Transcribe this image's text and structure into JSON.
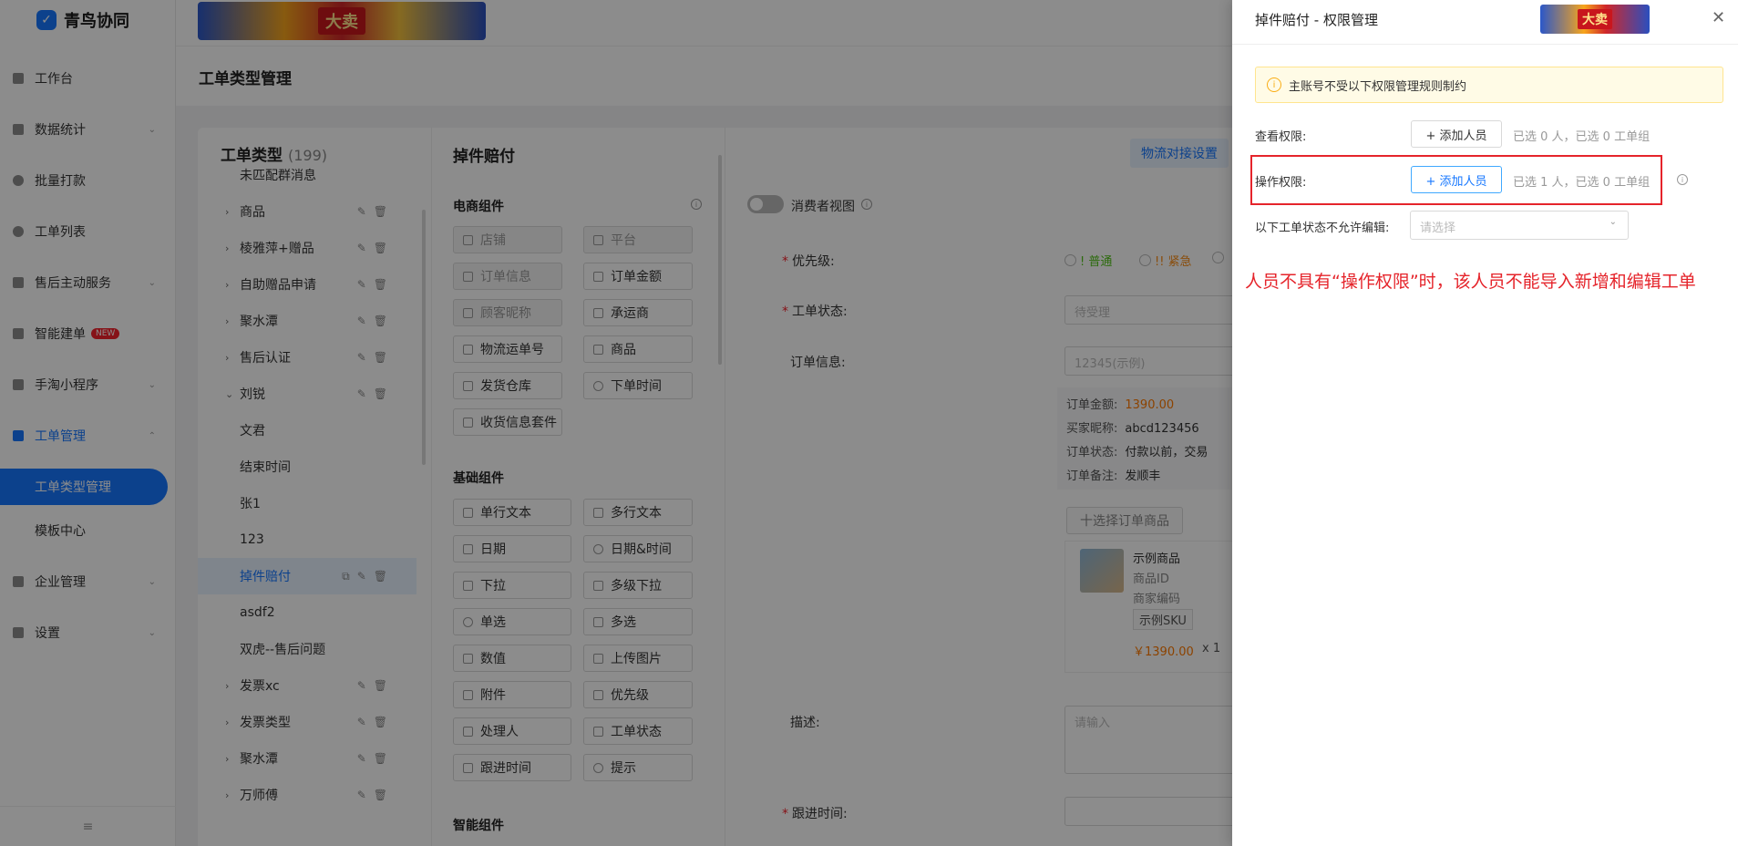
{
  "app": {
    "logo_text": "青鸟协同",
    "collapse_icon": "≡"
  },
  "sidebar": {
    "items": [
      {
        "label": "工作台"
      },
      {
        "label": "数据统计"
      },
      {
        "label": "批量打款"
      },
      {
        "label": "工单列表"
      },
      {
        "label": "售后主动服务"
      },
      {
        "label": "智能建单",
        "badge": "NEW"
      },
      {
        "label": "手淘小程序"
      },
      {
        "label": "工单管理"
      },
      {
        "label": "企业管理"
      },
      {
        "label": "设置"
      }
    ],
    "subitems": [
      {
        "label": "工单类型管理"
      },
      {
        "label": "模板中心"
      }
    ]
  },
  "banner": {
    "text": "大卖"
  },
  "page": {
    "title": "工单类型管理"
  },
  "tree": {
    "title": "工单类型",
    "count": "(199)",
    "rows": [
      {
        "label": "未匹配群消息"
      },
      {
        "label": "商品"
      },
      {
        "label": "棱雅萍+赠品"
      },
      {
        "label": "自助赠品申请"
      },
      {
        "label": "聚水潭"
      },
      {
        "label": "售后认证"
      },
      {
        "label": "刘锐"
      },
      {
        "label": "文君"
      },
      {
        "label": "结束时间"
      },
      {
        "label": "张1"
      },
      {
        "label": "123"
      },
      {
        "label": "掉件赔付"
      },
      {
        "label": "asdf2"
      },
      {
        "label": "双虎--售后问题"
      },
      {
        "label": "发票xc"
      },
      {
        "label": "发票类型"
      },
      {
        "label": "聚水潭"
      },
      {
        "label": "万师傅"
      }
    ]
  },
  "components": {
    "title": "掉件赔付",
    "logistics_label": "物流对接设置",
    "ecommerce_title": "电商组件",
    "ecommerce": [
      "店铺",
      "平台",
      "订单信息",
      "订单金额",
      "顾客昵称",
      "承运商",
      "物流运单号",
      "商品",
      "发货仓库",
      "下单时间",
      "收货信息套件"
    ],
    "basic_title": "基础组件",
    "basic": [
      "单行文本",
      "多行文本",
      "日期",
      "日期&时间",
      "下拉",
      "多级下拉",
      "单选",
      "多选",
      "数值",
      "上传图片",
      "附件",
      "优先级",
      "处理人",
      "工单状态",
      "跟进时间",
      "提示"
    ],
    "smart_title": "智能组件"
  },
  "preview": {
    "consumer_view": "消费者视图",
    "priority_label": "优先级:",
    "priority_normal": "! 普通",
    "priority_urgent": "!! 紧急",
    "status_label": "工单状态:",
    "status_placeholder": "待受理",
    "order_label": "订单信息:",
    "order_placeholder": "12345(示例)",
    "order_amount_k": "订单金额:",
    "order_amount_v": "1390.00",
    "buyer_k": "买家昵称:",
    "buyer_v": "abcd123456",
    "order_status_k": "订单状态:",
    "order_status_v": "付款以前，交易",
    "order_note_k": "订单备注:",
    "order_note_v": "发顺丰",
    "select_product": "十选择订单商品",
    "product_name": "示例商品",
    "product_id": "商品ID",
    "merchant_code": "商家编码",
    "sku": "示例SKU",
    "price": "￥1390.00",
    "qty": "x 1",
    "desc_label": "描述:",
    "desc_placeholder": "请输入",
    "follow_label": "跟进时间:"
  },
  "drawer": {
    "title": "掉件赔付 - 权限管理",
    "notice": "主账号不受以下权限管理规则制约",
    "view_label": "查看权限:",
    "view_btn": "+ 添加人员",
    "view_info": "已选 0 人，已选 0 工单组",
    "op_label": "操作权限:",
    "op_btn": "+ 添加人员",
    "op_info": "已选 1 人，已选 0 工单组",
    "lock_label": "以下工单状态不允许编辑:",
    "lock_placeholder": "请选择",
    "annotation": "人员不具有“操作权限”时，该人员不能导入新增和编辑工单"
  }
}
